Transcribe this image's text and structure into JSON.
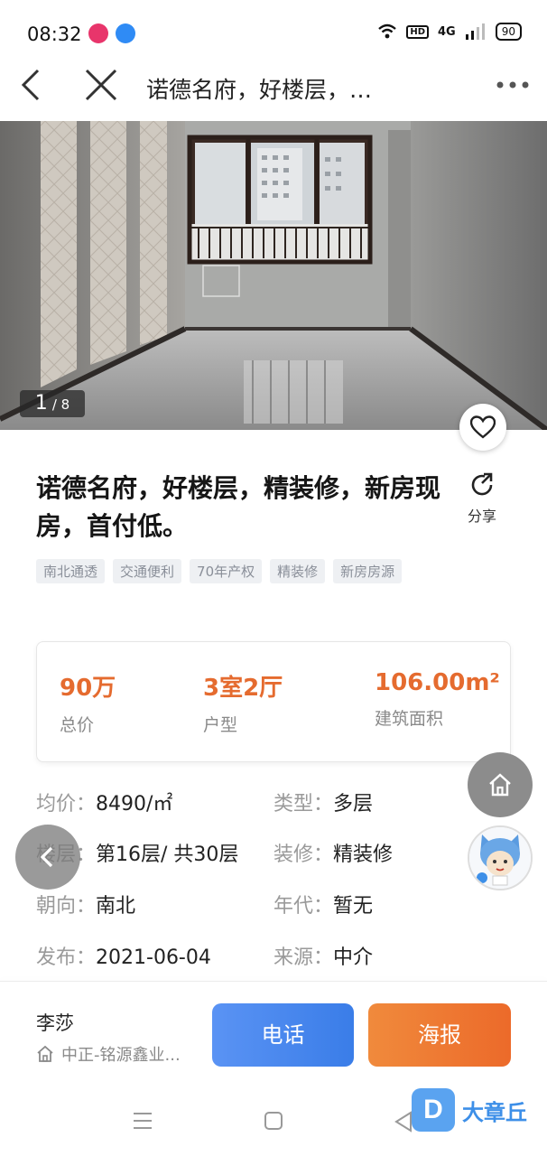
{
  "status_bar": {
    "time": "08:32",
    "network": "4G",
    "battery": "90"
  },
  "nav": {
    "title": "诺德名府，好楼层，…"
  },
  "gallery": {
    "current": "1",
    "total": "/ 8"
  },
  "listing": {
    "headline": "诺德名府，好楼层，精装修，新房现房，首付低。",
    "share_label": "分享",
    "tags": [
      "南北通透",
      "交通便利",
      "70年产权",
      "精装修",
      "新房房源"
    ]
  },
  "key_stats": [
    {
      "value": "90万",
      "label": "总价"
    },
    {
      "value": "3室2厅",
      "label": "户型"
    },
    {
      "value": "106.00m²",
      "label": "建筑面积"
    }
  ],
  "details": {
    "unit_price": {
      "key": "均价：",
      "value": "8490/㎡"
    },
    "type": {
      "key": "类型：",
      "value": "多层"
    },
    "floor": {
      "key": "楼层：",
      "value": "第16层/ 共30层"
    },
    "decoration": {
      "key": "装修：",
      "value": "精装修"
    },
    "orientation": {
      "key": "朝向：",
      "value": "南北"
    },
    "year": {
      "key": "年代：",
      "value": "暂无"
    },
    "published": {
      "key": "发布：",
      "value": "2021-06-04"
    },
    "source": {
      "key": "来源：",
      "value": "中介"
    }
  },
  "contact": {
    "agent_name": "李莎",
    "company": "中正-铭源鑫业...",
    "call_label": "电话",
    "poster_label": "海报"
  },
  "brand": {
    "logo_letter": "D",
    "name": "大章丘"
  },
  "colors": {
    "accent_orange": "#e56b2f",
    "call_blue": "#3a7de8",
    "poster_orange": "#ec6a2a"
  }
}
